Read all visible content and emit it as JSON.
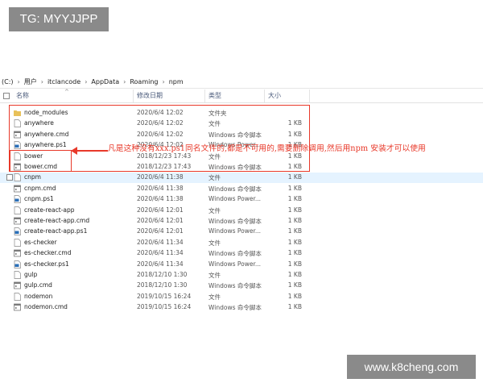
{
  "watermarks": {
    "top": "TG: MYYJJPP",
    "bottom": "www.k8cheng.com"
  },
  "path": [
    "(C:)",
    "用户",
    "itclancode",
    "AppData",
    "Roaming",
    "npm"
  ],
  "columns": {
    "name": "名称",
    "date": "修改日期",
    "type": "类型",
    "size": "大小"
  },
  "files": [
    {
      "name": "node_modules",
      "date": "2020/6/4 12:02",
      "type": "文件夹",
      "size": "",
      "icon": "folder-icon"
    },
    {
      "name": "anywhere",
      "date": "2020/6/4 12:02",
      "type": "文件",
      "size": "1 KB",
      "icon": "file-icon"
    },
    {
      "name": "anywhere.cmd",
      "date": "2020/6/4 12:02",
      "type": "Windows 命令脚本",
      "size": "1 KB",
      "icon": "cmd-icon"
    },
    {
      "name": "anywhere.ps1",
      "date": "2020/6/4 12:02",
      "type": "Windows Power...",
      "size": "1 KB",
      "icon": "ps1-icon"
    },
    {
      "name": "bower",
      "date": "2018/12/23 17:43",
      "type": "文件",
      "size": "1 KB",
      "icon": "file-icon"
    },
    {
      "name": "bower.cmd",
      "date": "2018/12/23 17:43",
      "type": "Windows 命令脚本",
      "size": "1 KB",
      "icon": "cmd-icon"
    },
    {
      "name": "cnpm",
      "date": "2020/6/4 11:38",
      "type": "文件",
      "size": "1 KB",
      "icon": "file-icon"
    },
    {
      "name": "cnpm.cmd",
      "date": "2020/6/4 11:38",
      "type": "Windows 命令脚本",
      "size": "1 KB",
      "icon": "cmd-icon"
    },
    {
      "name": "cnpm.ps1",
      "date": "2020/6/4 11:38",
      "type": "Windows Power...",
      "size": "1 KB",
      "icon": "ps1-icon"
    },
    {
      "name": "create-react-app",
      "date": "2020/6/4 12:01",
      "type": "文件",
      "size": "1 KB",
      "icon": "file-icon"
    },
    {
      "name": "create-react-app.cmd",
      "date": "2020/6/4 12:01",
      "type": "Windows 命令脚本",
      "size": "1 KB",
      "icon": "cmd-icon"
    },
    {
      "name": "create-react-app.ps1",
      "date": "2020/6/4 12:01",
      "type": "Windows Power...",
      "size": "1 KB",
      "icon": "ps1-icon"
    },
    {
      "name": "es-checker",
      "date": "2020/6/4 11:34",
      "type": "文件",
      "size": "1 KB",
      "icon": "file-icon"
    },
    {
      "name": "es-checker.cmd",
      "date": "2020/6/4 11:34",
      "type": "Windows 命令脚本",
      "size": "1 KB",
      "icon": "cmd-icon"
    },
    {
      "name": "es-checker.ps1",
      "date": "2020/6/4 11:34",
      "type": "Windows Power...",
      "size": "1 KB",
      "icon": "ps1-icon"
    },
    {
      "name": "gulp",
      "date": "2018/12/10 1:30",
      "type": "文件",
      "size": "1 KB",
      "icon": "file-icon"
    },
    {
      "name": "gulp.cmd",
      "date": "2018/12/10 1:30",
      "type": "Windows 命令脚本",
      "size": "1 KB",
      "icon": "cmd-icon"
    },
    {
      "name": "nodemon",
      "date": "2019/10/15 16:24",
      "type": "文件",
      "size": "1 KB",
      "icon": "file-icon"
    },
    {
      "name": "nodemon.cmd",
      "date": "2019/10/15 16:24",
      "type": "Windows 命令脚本",
      "size": "1 KB",
      "icon": "cmd-icon"
    }
  ],
  "selected_index": 6,
  "annotation": "凡是这种没有xxx.ps1同名文件的,都是不可用的,需要删除调用,然后用npm 安装才可以使用",
  "colors": {
    "annotation": "#e8392a",
    "selection": "#e5f3ff",
    "folder": "#e8c15a"
  }
}
